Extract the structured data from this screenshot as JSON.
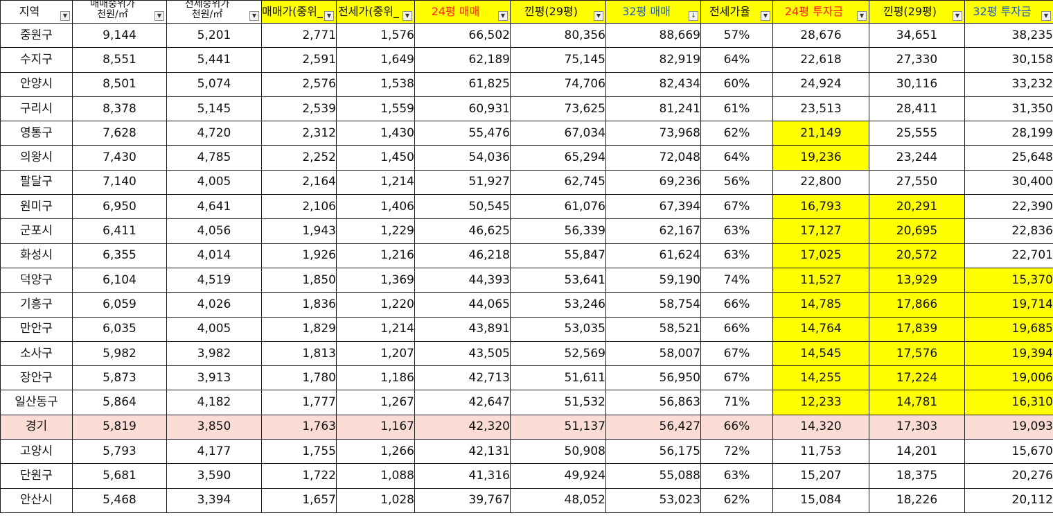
{
  "headers": [
    {
      "label": "지역",
      "lines": null
    },
    {
      "label": "매매중위가 천원/㎡",
      "lines": [
        "매매중위가",
        "천원/㎡"
      ]
    },
    {
      "label": "전세중위가 천원/㎡",
      "lines": [
        "전세중위가",
        "천원/㎡"
      ]
    },
    {
      "label": "매매가(중위_",
      "lines": null
    },
    {
      "label": "전세가(중위_",
      "lines": null
    },
    {
      "label": "24평 매매",
      "lines": null
    },
    {
      "label": "낀평(29평)",
      "lines": null
    },
    {
      "label": "32평 매매",
      "lines": null
    },
    {
      "label": "전세가율",
      "lines": null
    },
    {
      "label": "24평 투자금",
      "lines": null
    },
    {
      "label": "낀평(29평)",
      "lines": null
    },
    {
      "label": "32평 투자금",
      "lines": null
    }
  ],
  "header_colors": {
    "highlight": "#ffff00",
    "red_text": "#ff1a1a",
    "blue_text": "#1f5fbf",
    "row_highlight": "#fbdcd4"
  },
  "filter_icons": [
    "chevron-down-icon",
    "sort-desc-icon"
  ],
  "rows": [
    {
      "region": "중원구",
      "sale_m2": "9,144",
      "jeonse_m2": "5,201",
      "sale_mid": "2,771",
      "jeonse_mid": "1,576",
      "p24": "66,502",
      "p29": "80,356",
      "p32": "88,669",
      "ratio": "57%",
      "inv24": "28,676",
      "inv29": "34,651",
      "inv32": "38,235",
      "y24": false,
      "y29": false,
      "y32": false,
      "hl": false
    },
    {
      "region": "수지구",
      "sale_m2": "8,551",
      "jeonse_m2": "5,441",
      "sale_mid": "2,591",
      "jeonse_mid": "1,649",
      "p24": "62,189",
      "p29": "75,145",
      "p32": "82,919",
      "ratio": "64%",
      "inv24": "22,618",
      "inv29": "27,330",
      "inv32": "30,158",
      "y24": false,
      "y29": false,
      "y32": false,
      "hl": false
    },
    {
      "region": "안양시",
      "sale_m2": "8,501",
      "jeonse_m2": "5,074",
      "sale_mid": "2,576",
      "jeonse_mid": "1,538",
      "p24": "61,825",
      "p29": "74,706",
      "p32": "82,434",
      "ratio": "60%",
      "inv24": "24,924",
      "inv29": "30,116",
      "inv32": "33,232",
      "y24": false,
      "y29": false,
      "y32": false,
      "hl": false
    },
    {
      "region": "구리시",
      "sale_m2": "8,378",
      "jeonse_m2": "5,145",
      "sale_mid": "2,539",
      "jeonse_mid": "1,559",
      "p24": "60,931",
      "p29": "73,625",
      "p32": "81,241",
      "ratio": "61%",
      "inv24": "23,513",
      "inv29": "28,411",
      "inv32": "31,350",
      "y24": false,
      "y29": false,
      "y32": false,
      "hl": false
    },
    {
      "region": "영통구",
      "sale_m2": "7,628",
      "jeonse_m2": "4,720",
      "sale_mid": "2,312",
      "jeonse_mid": "1,430",
      "p24": "55,476",
      "p29": "67,034",
      "p32": "73,968",
      "ratio": "62%",
      "inv24": "21,149",
      "inv29": "25,555",
      "inv32": "28,199",
      "y24": true,
      "y29": false,
      "y32": false,
      "hl": false
    },
    {
      "region": "의왕시",
      "sale_m2": "7,430",
      "jeonse_m2": "4,785",
      "sale_mid": "2,252",
      "jeonse_mid": "1,450",
      "p24": "54,036",
      "p29": "65,294",
      "p32": "72,048",
      "ratio": "64%",
      "inv24": "19,236",
      "inv29": "23,244",
      "inv32": "25,648",
      "y24": true,
      "y29": false,
      "y32": false,
      "hl": false
    },
    {
      "region": "팔달구",
      "sale_m2": "7,140",
      "jeonse_m2": "4,005",
      "sale_mid": "2,164",
      "jeonse_mid": "1,214",
      "p24": "51,927",
      "p29": "62,745",
      "p32": "69,236",
      "ratio": "56%",
      "inv24": "22,800",
      "inv29": "27,550",
      "inv32": "30,400",
      "y24": false,
      "y29": false,
      "y32": false,
      "hl": false
    },
    {
      "region": "원미구",
      "sale_m2": "6,950",
      "jeonse_m2": "4,641",
      "sale_mid": "2,106",
      "jeonse_mid": "1,406",
      "p24": "50,545",
      "p29": "61,076",
      "p32": "67,394",
      "ratio": "67%",
      "inv24": "16,793",
      "inv29": "20,291",
      "inv32": "22,390",
      "y24": true,
      "y29": true,
      "y32": false,
      "hl": false
    },
    {
      "region": "군포시",
      "sale_m2": "6,411",
      "jeonse_m2": "4,056",
      "sale_mid": "1,943",
      "jeonse_mid": "1,229",
      "p24": "46,625",
      "p29": "56,339",
      "p32": "62,167",
      "ratio": "63%",
      "inv24": "17,127",
      "inv29": "20,695",
      "inv32": "22,836",
      "y24": true,
      "y29": true,
      "y32": false,
      "hl": false
    },
    {
      "region": "화성시",
      "sale_m2": "6,355",
      "jeonse_m2": "4,014",
      "sale_mid": "1,926",
      "jeonse_mid": "1,216",
      "p24": "46,218",
      "p29": "55,847",
      "p32": "61,624",
      "ratio": "63%",
      "inv24": "17,025",
      "inv29": "20,572",
      "inv32": "22,701",
      "y24": true,
      "y29": true,
      "y32": false,
      "hl": false
    },
    {
      "region": "덕양구",
      "sale_m2": "6,104",
      "jeonse_m2": "4,519",
      "sale_mid": "1,850",
      "jeonse_mid": "1,369",
      "p24": "44,393",
      "p29": "53,641",
      "p32": "59,190",
      "ratio": "74%",
      "inv24": "11,527",
      "inv29": "13,929",
      "inv32": "15,370",
      "y24": true,
      "y29": true,
      "y32": true,
      "hl": false
    },
    {
      "region": "기흥구",
      "sale_m2": "6,059",
      "jeonse_m2": "4,026",
      "sale_mid": "1,836",
      "jeonse_mid": "1,220",
      "p24": "44,065",
      "p29": "53,246",
      "p32": "58,754",
      "ratio": "66%",
      "inv24": "14,785",
      "inv29": "17,866",
      "inv32": "19,714",
      "y24": true,
      "y29": true,
      "y32": true,
      "hl": false
    },
    {
      "region": "만안구",
      "sale_m2": "6,035",
      "jeonse_m2": "4,005",
      "sale_mid": "1,829",
      "jeonse_mid": "1,214",
      "p24": "43,891",
      "p29": "53,035",
      "p32": "58,521",
      "ratio": "66%",
      "inv24": "14,764",
      "inv29": "17,839",
      "inv32": "19,685",
      "y24": true,
      "y29": true,
      "y32": true,
      "hl": false
    },
    {
      "region": "소사구",
      "sale_m2": "5,982",
      "jeonse_m2": "3,982",
      "sale_mid": "1,813",
      "jeonse_mid": "1,207",
      "p24": "43,505",
      "p29": "52,569",
      "p32": "58,007",
      "ratio": "67%",
      "inv24": "14,545",
      "inv29": "17,576",
      "inv32": "19,394",
      "y24": true,
      "y29": true,
      "y32": true,
      "hl": false
    },
    {
      "region": "장안구",
      "sale_m2": "5,873",
      "jeonse_m2": "3,913",
      "sale_mid": "1,780",
      "jeonse_mid": "1,186",
      "p24": "42,713",
      "p29": "51,611",
      "p32": "56,950",
      "ratio": "67%",
      "inv24": "14,255",
      "inv29": "17,224",
      "inv32": "19,006",
      "y24": true,
      "y29": true,
      "y32": true,
      "hl": false
    },
    {
      "region": "일산동구",
      "sale_m2": "5,864",
      "jeonse_m2": "4,182",
      "sale_mid": "1,777",
      "jeonse_mid": "1,267",
      "p24": "42,647",
      "p29": "51,532",
      "p32": "56,863",
      "ratio": "71%",
      "inv24": "12,233",
      "inv29": "14,781",
      "inv32": "16,310",
      "y24": true,
      "y29": true,
      "y32": true,
      "hl": false
    },
    {
      "region": "경기",
      "sale_m2": "5,819",
      "jeonse_m2": "3,850",
      "sale_mid": "1,763",
      "jeonse_mid": "1,167",
      "p24": "42,320",
      "p29": "51,137",
      "p32": "56,427",
      "ratio": "66%",
      "inv24": "14,320",
      "inv29": "17,303",
      "inv32": "19,093",
      "y24": false,
      "y29": false,
      "y32": false,
      "hl": true
    },
    {
      "region": "고양시",
      "sale_m2": "5,793",
      "jeonse_m2": "4,177",
      "sale_mid": "1,755",
      "jeonse_mid": "1,266",
      "p24": "42,131",
      "p29": "50,908",
      "p32": "56,175",
      "ratio": "72%",
      "inv24": "11,753",
      "inv29": "14,201",
      "inv32": "15,670",
      "y24": false,
      "y29": false,
      "y32": false,
      "hl": false
    },
    {
      "region": "단원구",
      "sale_m2": "5,681",
      "jeonse_m2": "3,590",
      "sale_mid": "1,722",
      "jeonse_mid": "1,088",
      "p24": "41,316",
      "p29": "49,924",
      "p32": "55,088",
      "ratio": "63%",
      "inv24": "15,207",
      "inv29": "18,375",
      "inv32": "20,276",
      "y24": false,
      "y29": false,
      "y32": false,
      "hl": false
    },
    {
      "region": "안산시",
      "sale_m2": "5,468",
      "jeonse_m2": "3,394",
      "sale_mid": "1,657",
      "jeonse_mid": "1,028",
      "p24": "39,767",
      "p29": "48,052",
      "p32": "53,023",
      "ratio": "62%",
      "inv24": "15,084",
      "inv29": "18,226",
      "inv32": "20,112",
      "y24": false,
      "y29": false,
      "y32": false,
      "hl": false
    }
  ]
}
